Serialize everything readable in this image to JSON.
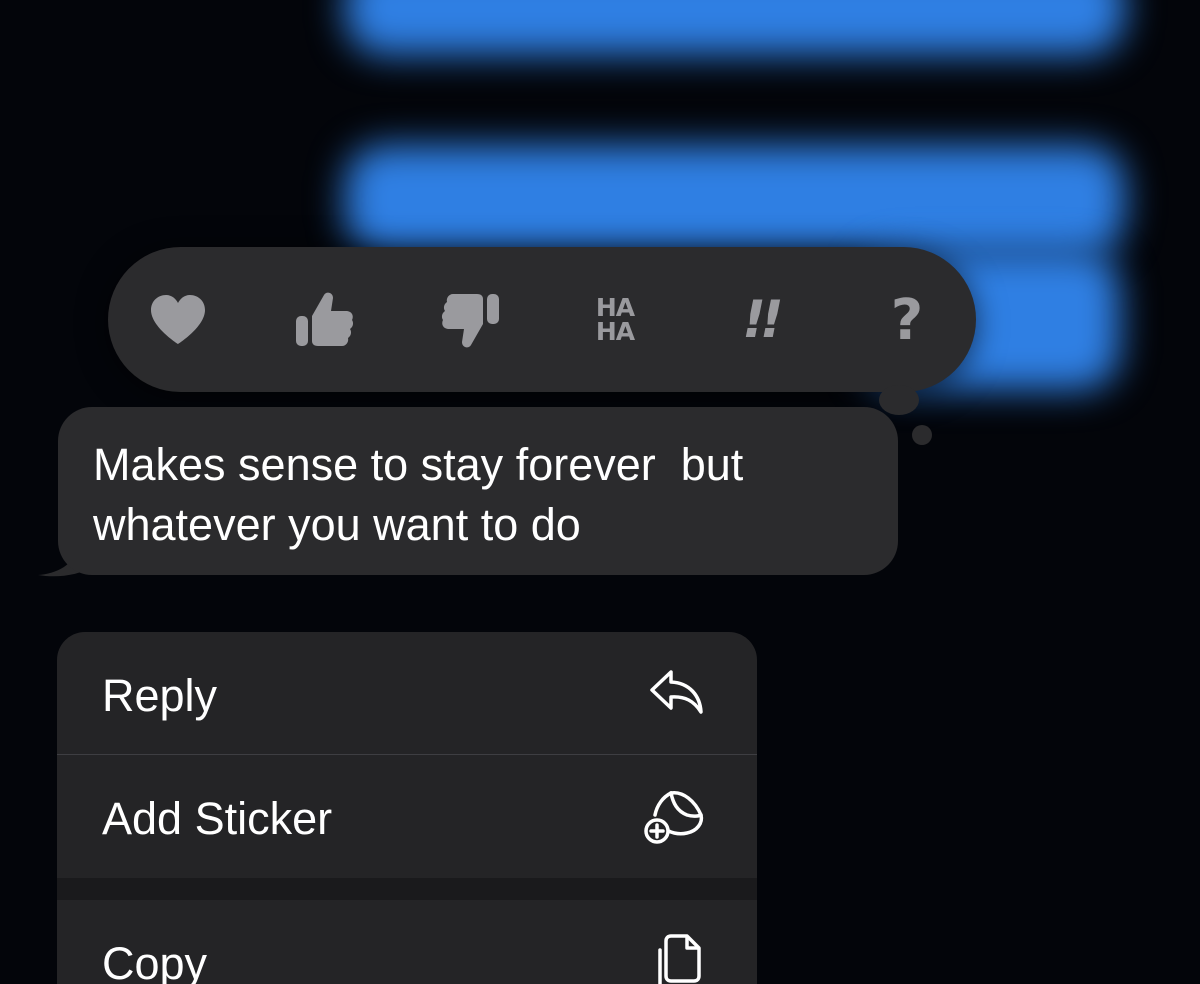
{
  "reactions": [
    {
      "name": "heart",
      "icon": "heart-icon"
    },
    {
      "name": "like",
      "icon": "thumbs-up-icon"
    },
    {
      "name": "dislike",
      "icon": "thumbs-down-icon"
    },
    {
      "name": "laugh",
      "icon": "haha-icon",
      "text_line1": "HA",
      "text_line2": "HA"
    },
    {
      "name": "emphasize",
      "icon": "double-exclamation-icon",
      "text": "!!"
    },
    {
      "name": "question",
      "icon": "question-mark-icon",
      "text": "?"
    }
  ],
  "message": {
    "text": "Makes sense to stay forever  but\nwhatever you want to do"
  },
  "menu": {
    "items": [
      {
        "label": "Reply",
        "icon": "reply-arrow-icon"
      },
      {
        "label": "Add Sticker",
        "icon": "add-sticker-icon"
      },
      {
        "label": "Copy",
        "icon": "copy-icon"
      }
    ]
  },
  "colors": {
    "background": "#03050a",
    "blurred_bubble": "#2f7fe3",
    "bubble": "#2b2b2d",
    "menu": "#242426",
    "reaction_icon": "#9a9a9e",
    "text": "#ffffff"
  }
}
